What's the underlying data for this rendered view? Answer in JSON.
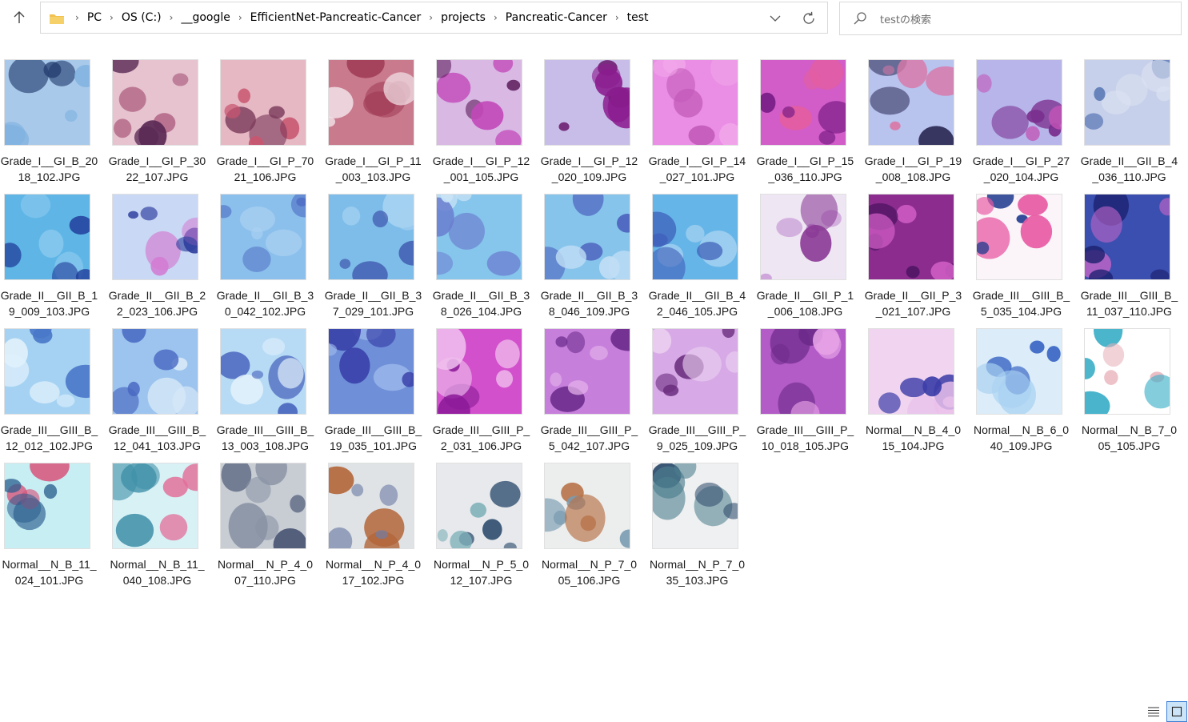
{
  "address_bar": {
    "breadcrumbs": [
      "PC",
      "OS (C:)",
      "__google",
      "EfficientNet-Pancreatic-Cancer",
      "projects",
      "Pancreatic-Cancer",
      "test"
    ]
  },
  "search": {
    "placeholder": "testの検索"
  },
  "files": [
    {
      "name": "Grade_I__GI_B_2018_102.JPG",
      "bg": "#a9c9ea",
      "c1": "#7fb2e0",
      "c2": "#223b6e"
    },
    {
      "name": "Grade_I__GI_P_3022_107.JPG",
      "bg": "#e6c3cf",
      "c1": "#b46a88",
      "c2": "#5a2a55"
    },
    {
      "name": "Grade_I__GI_P_7021_106.JPG",
      "bg": "#e6b8c3",
      "c1": "#c85670",
      "c2": "#7a3a5a"
    },
    {
      "name": "Grade_I__GI_P_11_003_103.JPG",
      "bg": "#c97a8d",
      "c1": "#a03a55",
      "c2": "#f3e5ea"
    },
    {
      "name": "Grade_I__GI_P_12_001_105.JPG",
      "bg": "#d9b8e4",
      "c1": "#c247b9",
      "c2": "#5b1a5a"
    },
    {
      "name": "Grade_I__GI_P_12_020_109.JPG",
      "bg": "#c8bde8",
      "c1": "#8b1d8f",
      "c2": "#6b1a6e"
    },
    {
      "name": "Grade_I__GI_P_14_027_101.JPG",
      "bg": "#e98ee4",
      "c1": "#f1a5ea",
      "c2": "#c25ab8"
    },
    {
      "name": "Grade_I__GI_P_15_036_110.JPG",
      "bg": "#d25dc8",
      "c1": "#7a1e86",
      "c2": "#e35ea0"
    },
    {
      "name": "Grade_I__GI_P_19_008_108.JPG",
      "bg": "#b8c3ee",
      "c1": "#d978a8",
      "c2": "#2a2a55"
    },
    {
      "name": "Grade_I__GI_P_27_020_104.JPG",
      "bg": "#b7b5ea",
      "c1": "#7a2e8e",
      "c2": "#c354b6"
    },
    {
      "name": "Grade_II__GII_B_4_036_110.JPG",
      "bg": "#c7d0ea",
      "c1": "#dbe2f2",
      "c2": "#3b5fa5"
    },
    {
      "name": "Grade_II__GII_B_19_009_103.JPG",
      "bg": "#5fb6e6",
      "c1": "#1f3b9a",
      "c2": "#8ecbef"
    },
    {
      "name": "Grade_II__GII_B_22_023_106.JPG",
      "bg": "#c9d8f4",
      "c1": "#2f3f9e",
      "c2": "#d27bd2"
    },
    {
      "name": "Grade_II__GII_B_30_042_102.JPG",
      "bg": "#8cc0ec",
      "c1": "#4f6fc5",
      "c2": "#a8d0f2"
    },
    {
      "name": "Grade_II__GII_B_37_029_101.JPG",
      "bg": "#7ebde9",
      "c1": "#3a4faa",
      "c2": "#a6d2f1"
    },
    {
      "name": "Grade_II__GII_B_38_026_104.JPG",
      "bg": "#86c5ec",
      "c1": "#6b7fd0",
      "c2": "#c9e4f6"
    },
    {
      "name": "Grade_II__GII_B_38_046_109.JPG",
      "bg": "#87c4ec",
      "c1": "#4a5fbc",
      "c2": "#c0def5"
    },
    {
      "name": "Grade_II__GII_B_42_046_105.JPG",
      "bg": "#66b5e8",
      "c1": "#3d5cb8",
      "c2": "#a9d3f1"
    },
    {
      "name": "Grade_II__GII_P_1_006_108.JPG",
      "bg": "#efe6f3",
      "c1": "#c79ad6",
      "c2": "#8a3a96"
    },
    {
      "name": "Grade_II__GII_P_3_021_107.JPG",
      "bg": "#8b2c8e",
      "c1": "#4a1360",
      "c2": "#d25fc6"
    },
    {
      "name": "Grade_III__GIII_B_5_035_104.JPG",
      "bg": "#fbf4f8",
      "c1": "#e85aa4",
      "c2": "#1e3a8e"
    },
    {
      "name": "Grade_III__GIII_B_11_037_110.JPG",
      "bg": "#3a4fb0",
      "c1": "#1b1f6e",
      "c2": "#b764c4"
    },
    {
      "name": "Grade_III__GIII_B_12_012_102.JPG",
      "bg": "#a5d2f2",
      "c1": "#dff0fb",
      "c2": "#4a78c9"
    },
    {
      "name": "Grade_III__GIII_B_12_041_103.JPG",
      "bg": "#9cc4ee",
      "c1": "#4868c2",
      "c2": "#d6e8f8"
    },
    {
      "name": "Grade_III__GIII_B_13_003_108.JPG",
      "bg": "#b7dbf5",
      "c1": "#3d59b8",
      "c2": "#e3f1fb"
    },
    {
      "name": "Grade_III__GIII_B_19_035_101.JPG",
      "bg": "#6f8fd9",
      "c1": "#3840a8",
      "c2": "#a7c0ef"
    },
    {
      "name": "Grade_III__GIII_P_2_031_106.JPG",
      "bg": "#d250cc",
      "c1": "#f1c2ee",
      "c2": "#8a1a98"
    },
    {
      "name": "Grade_III__GIII_P_5_042_107.JPG",
      "bg": "#c77fdc",
      "c1": "#6a2a8a",
      "c2": "#e3b1ea"
    },
    {
      "name": "Grade_III__GIII_P_9_025_109.JPG",
      "bg": "#d7a9e6",
      "c1": "#6a2d7e",
      "c2": "#ead0f0"
    },
    {
      "name": "Grade_III__GIII_P_10_018_105.JPG",
      "bg": "#b35bc7",
      "c1": "#6c2a8a",
      "c2": "#e6a2e6"
    },
    {
      "name": "Normal__N_B_4_015_104.JPG",
      "bg": "#f1d5f0",
      "c1": "#3d3ea8",
      "c2": "#e9c0ea"
    },
    {
      "name": "Normal__N_B_6_040_109.JPG",
      "bg": "#dcedf9",
      "c1": "#3b66c4",
      "c2": "#a9d1f2"
    },
    {
      "name": "Normal__N_B_7_005_105.JPG",
      "bg": "#ffffff",
      "c1": "#3fb0c8",
      "c2": "#e7b0b8"
    },
    {
      "name": "Normal__N_B_11_024_101.JPG",
      "bg": "#c7eef3",
      "c1": "#2a5e8e",
      "c2": "#d8527a"
    },
    {
      "name": "Normal__N_B_11_040_108.JPG",
      "bg": "#d8f1f5",
      "c1": "#3e8fa8",
      "c2": "#e26c97"
    },
    {
      "name": "Normal__N_P_4_007_110.JPG",
      "bg": "#c8ccd3",
      "c1": "#8a93a5",
      "c2": "#3d4a6a"
    },
    {
      "name": "Normal__N_P_4_017_102.JPG",
      "bg": "#dfe3e6",
      "c1": "#6f7ea6",
      "c2": "#b3663a"
    },
    {
      "name": "Normal__N_P_5_012_107.JPG",
      "bg": "#e7e9ec",
      "c1": "#2e4c6e",
      "c2": "#7fb0b9"
    },
    {
      "name": "Normal__N_P_7_005_106.JPG",
      "bg": "#eceeee",
      "c1": "#7a9bb0",
      "c2": "#b8734a"
    },
    {
      "name": "Normal__N_P_7_035_103.JPG",
      "bg": "#eff0f1",
      "c1": "#4d7e8f",
      "c2": "#2f4c6c"
    }
  ],
  "icons": {
    "up": "arrow-up-icon",
    "folder": "folder-icon",
    "refresh": "refresh-icon",
    "search": "search-icon",
    "view_details": "details-view-icon",
    "view_large": "large-icons-view-icon"
  },
  "colors": {
    "accent": "#3c7fd6",
    "selected_bg": "#cce4f7",
    "folder": "#f2c14e"
  }
}
